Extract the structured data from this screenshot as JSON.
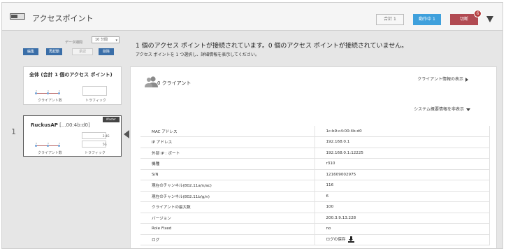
{
  "header": {
    "title": "アクセスポイント",
    "total_label": "合計 1",
    "running_label": "動作中 1",
    "disconnected_label": "切断",
    "alarm_count": "6"
  },
  "left": {
    "period_label": "データ期間",
    "period_value": "10 分間",
    "buttons": [
      "編集",
      "再起動",
      "承認",
      "削除"
    ],
    "all_card": {
      "title": "全体 (合計 1 個のアクセス ポイント)",
      "clients_label": "クライアント数",
      "traffic_label": "トラフィック",
      "spark_values": [
        "0",
        "0",
        "0"
      ]
    },
    "ap_card": {
      "index": "1",
      "name": "RuckusAP",
      "mac_short": "[...00:4b:d0]",
      "tag": "Master",
      "band_24": "2.4G",
      "band_5": "5G",
      "clients_label": "クライアント数",
      "traffic_label": "トラフィック",
      "spark_values": [
        "0",
        "0",
        "0"
      ]
    }
  },
  "main": {
    "summary": "1 個のアクセス ポイントが接続されています。0 個のアクセス ポイントが接続されていません。",
    "hint": "アクセス ポイントを 1 つ選択し、詳細情報を表示してください。",
    "client_count": "0 クライアント",
    "show_clients_link": "クライアント情報の表示",
    "hide_summary_link": "システム概要情報を非表示",
    "properties": [
      {
        "key": "MAC アドレス",
        "value": "1c:b9:c4:00:4b:d0"
      },
      {
        "key": "IP アドレス",
        "value": "192.168.0.1"
      },
      {
        "key": "外部 IP : ポート",
        "value": "192.168.0.1:12225"
      },
      {
        "key": "機種",
        "value": "r310"
      },
      {
        "key": "S/N",
        "value": "121609002975"
      },
      {
        "key": "現在のチャンネル(802.11a/n/ac)",
        "value": "116"
      },
      {
        "key": "現在のチャンネル(802.11b/g/n)",
        "value": "6"
      },
      {
        "key": "クライアントの最大数",
        "value": "100"
      },
      {
        "key": "バージョン",
        "value": "200.3.9.13.228"
      },
      {
        "key": "Role Fixed",
        "value": "no"
      },
      {
        "key": "ログ",
        "value": "ログの保存"
      }
    ]
  }
}
